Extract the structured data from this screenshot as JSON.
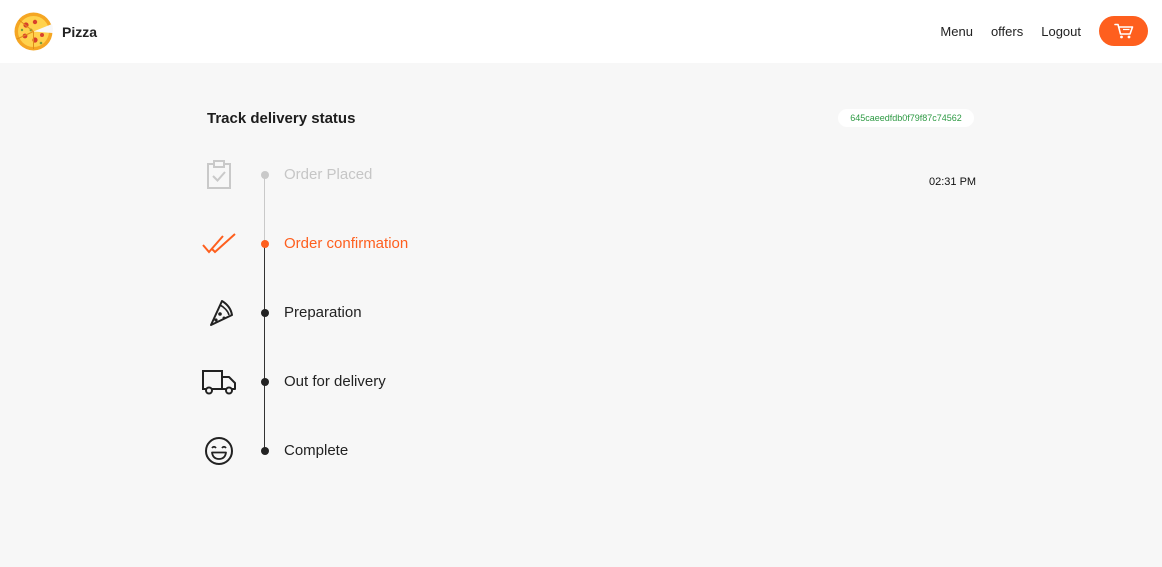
{
  "header": {
    "brand_name": "Pizza",
    "logo_icon": "pizza-logo-icon",
    "nav": [
      "Menu",
      "offers",
      "Logout"
    ],
    "cart_icon": "cart-icon"
  },
  "tracking": {
    "title": "Track delivery status",
    "order_id": "645caeedfdb0f79f87c74562",
    "time": "02:31 PM",
    "steps": [
      {
        "label": "Order Placed",
        "icon": "clipboard-check-icon",
        "state": "done"
      },
      {
        "label": "Order confirmation",
        "icon": "double-check-icon",
        "state": "current"
      },
      {
        "label": "Preparation",
        "icon": "pizza-slice-icon",
        "state": "pending"
      },
      {
        "label": "Out for delivery",
        "icon": "delivery-truck-icon",
        "state": "pending"
      },
      {
        "label": "Complete",
        "icon": "smiley-face-icon",
        "state": "pending"
      }
    ]
  },
  "colors": {
    "accent": "#fe5f1e",
    "done": "#c6c6c6",
    "order_id_text": "#2e9a44"
  }
}
